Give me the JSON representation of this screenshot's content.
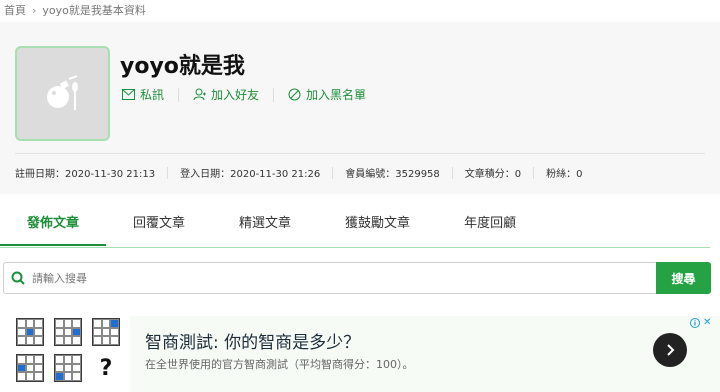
{
  "breadcrumb": {
    "home": "首頁",
    "current": "yoyo就是我基本資料"
  },
  "profile": {
    "name": "yoyo就是我",
    "actions": {
      "message": "私訊",
      "add_friend": "加入好友",
      "blacklist": "加入黑名單"
    },
    "stats": {
      "registered": "註冊日期：2020-11-30 21:13",
      "login": "登入日期：2020-11-30 21:26",
      "member_id": "會員編號：3529958",
      "article_points": "文章積分：0",
      "fans": "粉絲：0"
    }
  },
  "tabs": [
    "發佈文章",
    "回覆文章",
    "精選文章",
    "獲鼓勵文章",
    "年度回顧"
  ],
  "search": {
    "placeholder": "請輸入搜尋",
    "button": "搜尋"
  },
  "ad": {
    "title": "智商測試: 你的智商是多少？",
    "subtitle": "在全世界使用的官方智商測試（平均智商得分：100）。",
    "qmark": "?"
  },
  "colors": {
    "accent": "#1d8f3a",
    "button": "#25a244",
    "avatar_border": "#a8dfb0"
  }
}
